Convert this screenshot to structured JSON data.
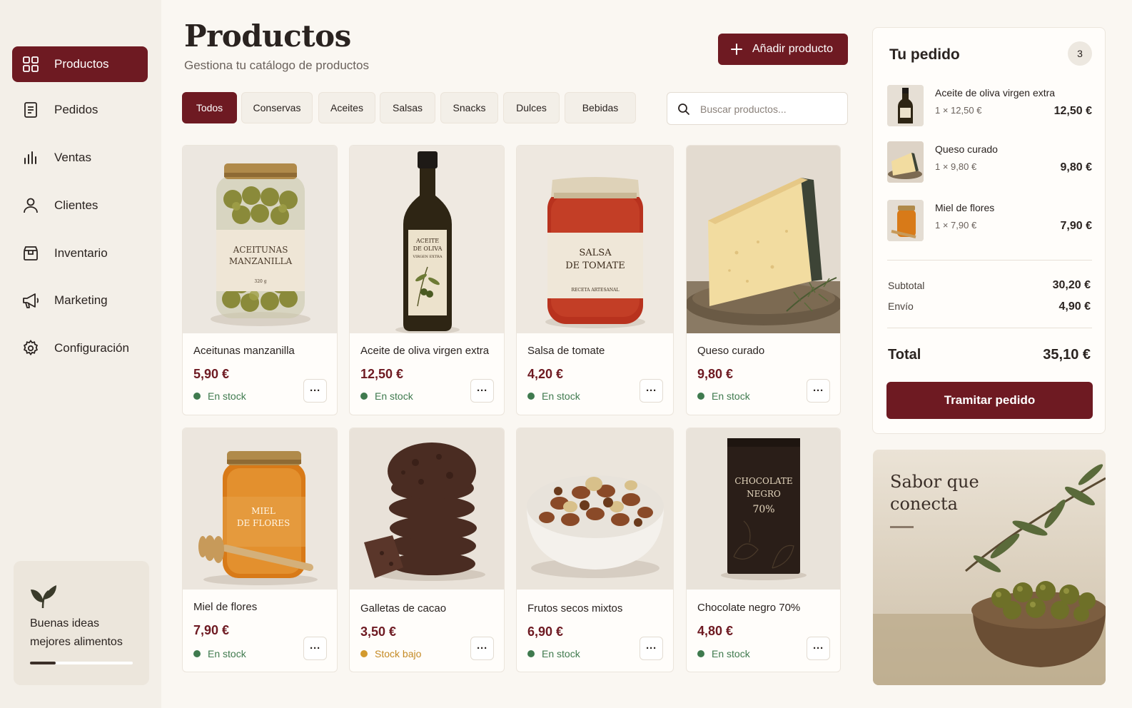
{
  "sidebar": {
    "items": [
      {
        "label": "Productos",
        "icon": "grid-icon",
        "active": true
      },
      {
        "label": "Pedidos",
        "icon": "document-icon",
        "active": false
      },
      {
        "label": "Ventas",
        "icon": "bar-chart-icon",
        "active": false
      },
      {
        "label": "Clientes",
        "icon": "user-icon",
        "active": false
      },
      {
        "label": "Inventario",
        "icon": "box-icon",
        "active": false
      },
      {
        "label": "Marketing",
        "icon": "megaphone-icon",
        "active": false
      },
      {
        "label": "Configuración",
        "icon": "gear-icon",
        "active": false
      }
    ],
    "promo": {
      "line1": "Buenas ideas",
      "line2": "mejores alimentos",
      "icon": "leaf-icon",
      "progress": 0.25
    }
  },
  "header": {
    "title": "Productos",
    "subtitle": "Gestiona tu catálogo de productos",
    "add_button_label": "Añadir producto"
  },
  "filters": [
    "Todos",
    "Conservas",
    "Aceites",
    "Salsas",
    "Snacks",
    "Dulces",
    "Bebidas"
  ],
  "active_filter": "Todos",
  "search": {
    "placeholder": "Buscar productos...",
    "value": ""
  },
  "products": [
    {
      "name": "Aceitunas manzanilla",
      "price": "5,90 €",
      "stock": "En stock",
      "stock_level": "ok",
      "image": "olive-jar",
      "label_lines": [
        "ACEITUNAS",
        "MANZANILLA",
        "320 g"
      ]
    },
    {
      "name": "Aceite de oliva virgen extra",
      "price": "12,50 €",
      "stock": "En stock",
      "stock_level": "ok",
      "image": "oil-bottle",
      "label_lines": [
        "ACEITE",
        "DE OLIVA",
        "VIRGEN EXTRA"
      ]
    },
    {
      "name": "Salsa de tomate",
      "price": "4,20 €",
      "stock": "En stock",
      "stock_level": "ok",
      "image": "tomato-jar",
      "label_lines": [
        "SALSA",
        "DE TOMATE",
        "RECETA ARTESANAL"
      ]
    },
    {
      "name": "Queso curado",
      "price": "9,80 €",
      "stock": "En stock",
      "stock_level": "ok",
      "image": "cheese"
    },
    {
      "name": "Miel de flores",
      "price": "7,90 €",
      "stock": "En stock",
      "stock_level": "ok",
      "image": "honey-jar",
      "label_lines": [
        "MIEL",
        "DE FLORES"
      ]
    },
    {
      "name": "Galletas de cacao",
      "price": "3,50 €",
      "stock": "Stock bajo",
      "stock_level": "low",
      "image": "cookies"
    },
    {
      "name": "Frutos secos mixtos",
      "price": "6,90 €",
      "stock": "En stock",
      "stock_level": "ok",
      "image": "nuts-bowl"
    },
    {
      "name": "Chocolate negro 70%",
      "price": "4,80 €",
      "stock": "En stock",
      "stock_level": "ok",
      "image": "chocolate-bar",
      "label_lines": [
        "CHOCOLATE",
        "NEGRO",
        "70%"
      ]
    }
  ],
  "more_button_label": "···",
  "order": {
    "title": "Tu pedido",
    "count": "3",
    "items": [
      {
        "name": "Aceite de oliva virgen extra",
        "qty": "1 × 12,50 €",
        "price": "12,50 €",
        "image": "oil-bottle"
      },
      {
        "name": "Queso curado",
        "qty": "1 × 9,80 €",
        "price": "9,80 €",
        "image": "cheese"
      },
      {
        "name": "Miel de flores",
        "qty": "1 × 7,90 €",
        "price": "7,90 €",
        "image": "honey-jar"
      }
    ],
    "subtotal_label": "Subtotal",
    "subtotal": "30,20 €",
    "shipping_label": "Envío",
    "shipping": "4,90 €",
    "total_label": "Total",
    "total": "35,10 €",
    "checkout_label": "Tramitar pedido"
  },
  "banner": {
    "line1": "Sabor que",
    "line2": "conecta"
  },
  "colors": {
    "accent": "#6e1a22",
    "stock_ok": "#3f7a4e",
    "stock_low": "#d39a2e",
    "background": "#faf7f2"
  }
}
